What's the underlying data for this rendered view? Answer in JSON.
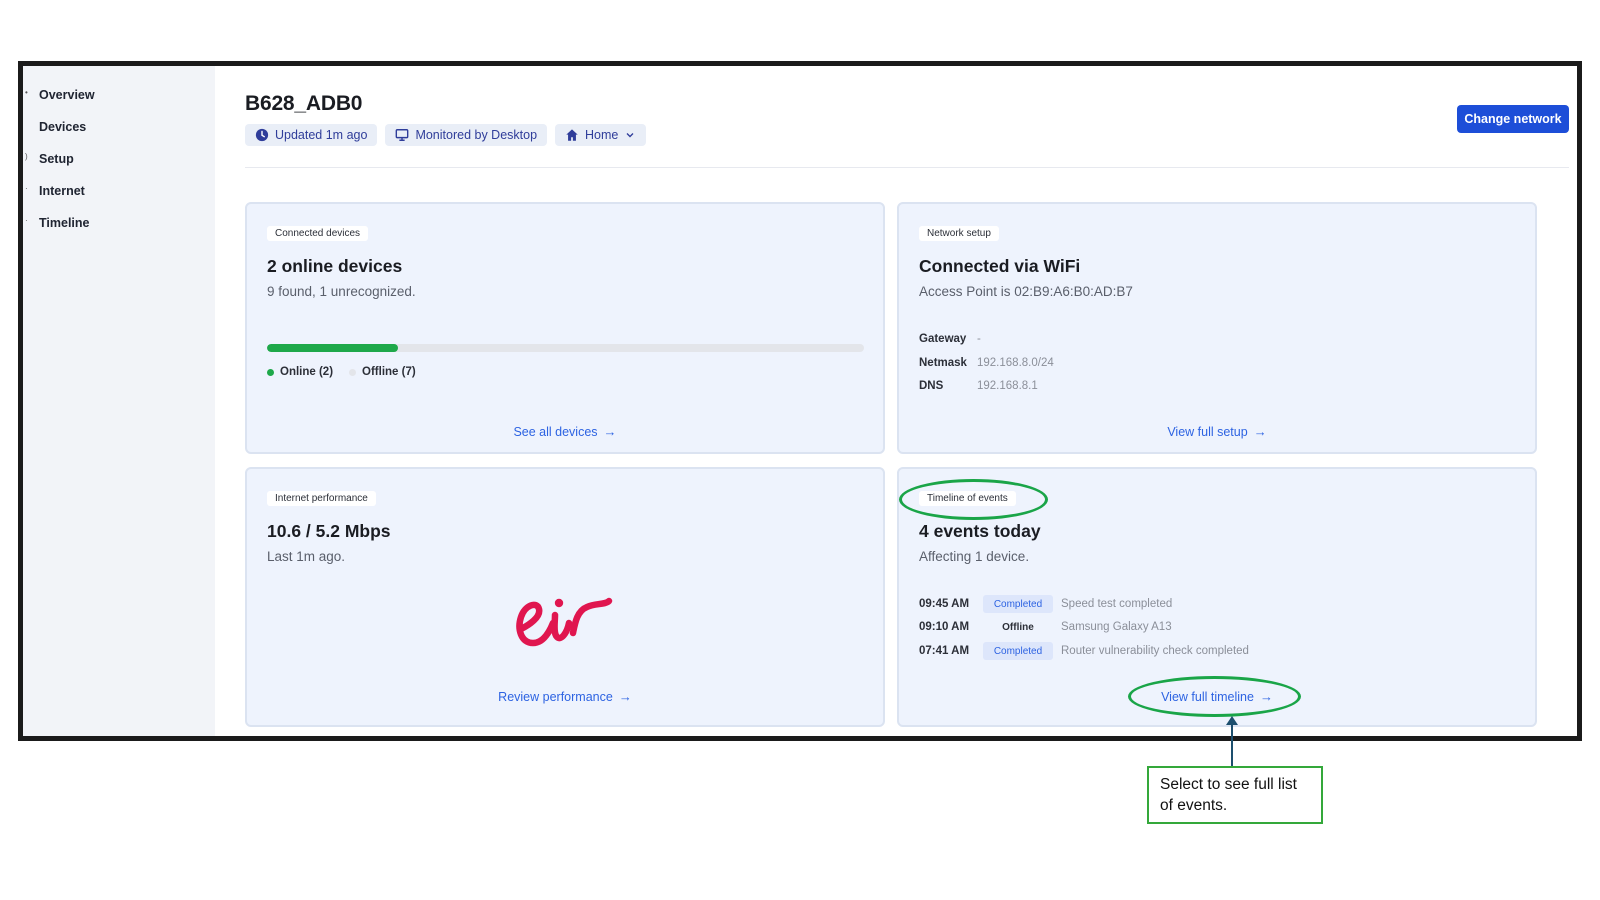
{
  "sidebar": {
    "items": [
      {
        "label": "Overview"
      },
      {
        "label": "Devices"
      },
      {
        "label": "Setup"
      },
      {
        "label": "Internet"
      },
      {
        "label": "Timeline"
      }
    ]
  },
  "header": {
    "title": "B628_ADB0",
    "chips": [
      {
        "label": "Updated 1m ago",
        "icon": "clock-icon"
      },
      {
        "label": "Monitored by Desktop",
        "icon": "monitor-icon"
      },
      {
        "label": "Home",
        "icon": "home-icon"
      }
    ],
    "change_network_label": "Change network"
  },
  "cards": {
    "devices": {
      "tag": "Connected devices",
      "title": "2 online devices",
      "subtitle": "9 found, 1 unrecognized.",
      "online_fraction": 0.22,
      "legend_online": "Online (2)",
      "legend_offline": "Offline (7)",
      "link": "See all devices"
    },
    "network": {
      "tag": "Network setup",
      "title": "Connected via WiFi",
      "subtitle": "Access Point is 02:B9:A6:B0:AD:B7",
      "rows": [
        {
          "key": "Gateway",
          "value": "-"
        },
        {
          "key": "Netmask",
          "value": "192.168.8.0/24"
        },
        {
          "key": "DNS",
          "value": "192.168.8.1"
        }
      ],
      "link": "View full setup"
    },
    "performance": {
      "tag": "Internet performance",
      "title": "10.6 / 5.2 Mbps",
      "subtitle": "Last 1m ago.",
      "logo_text": "eir",
      "link": "Review performance"
    },
    "timeline": {
      "tag": "Timeline of events",
      "title": "4 events today",
      "subtitle": "Affecting 1 device.",
      "events": [
        {
          "time": "09:45 AM",
          "status": "Completed",
          "desc": "Speed test completed"
        },
        {
          "time": "09:10 AM",
          "status": "Offline",
          "desc": "Samsung Galaxy A13"
        },
        {
          "time": "07:41 AM",
          "status": "Completed",
          "desc": "Router vulnerability check completed"
        }
      ],
      "link": "View full timeline"
    }
  },
  "annotation": {
    "callout_text": "Select to see full list of events."
  },
  "colors": {
    "accent": "#1d4ed8",
    "online": "#1ea84a",
    "annotation": "#1aa548",
    "brand_logo": "#e0164f"
  }
}
